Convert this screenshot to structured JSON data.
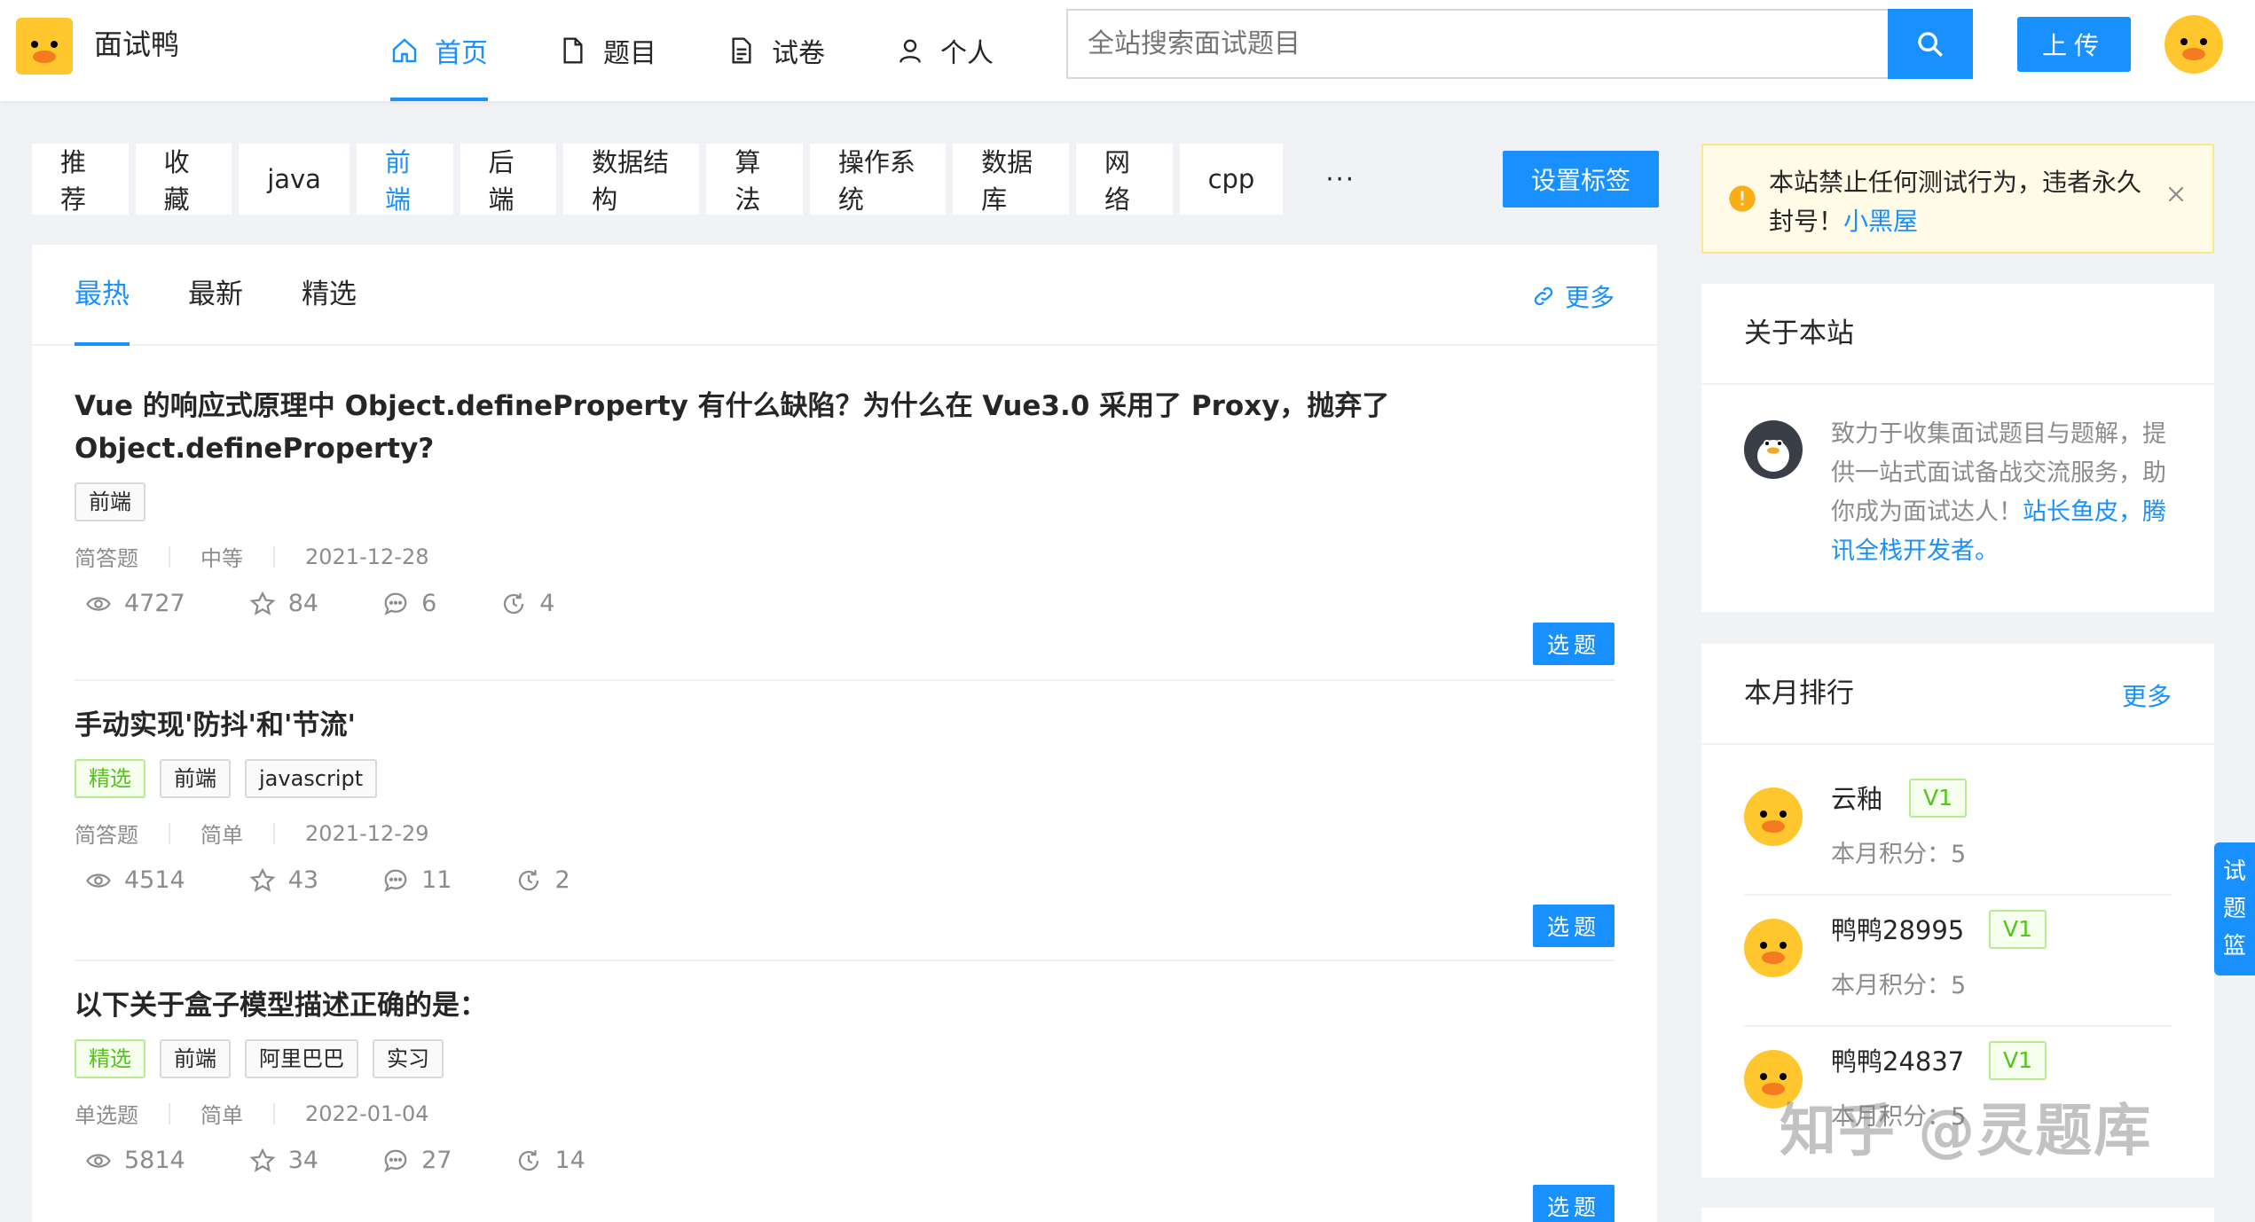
{
  "header": {
    "site_name": "面试鸭",
    "nav": [
      {
        "label": "首页",
        "icon": "home-icon",
        "active": true
      },
      {
        "label": "题目",
        "icon": "file-icon",
        "active": false
      },
      {
        "label": "试卷",
        "icon": "paper-icon",
        "active": false
      },
      {
        "label": "个人",
        "icon": "user-icon",
        "active": false
      }
    ],
    "search_placeholder": "全站搜索面试题目",
    "upload_label": "上传"
  },
  "tag_bar": {
    "tags": [
      "推荐",
      "收藏",
      "java",
      "前端",
      "后端",
      "数据结构",
      "算法",
      "操作系统",
      "数据库",
      "网络",
      "cpp"
    ],
    "active_tag": "前端",
    "more": "···",
    "set_tags_label": "设置标签"
  },
  "main": {
    "tabs": [
      "最热",
      "最新",
      "精选"
    ],
    "active_tab": "最热",
    "more_label": "更多",
    "pick_label": "选题",
    "questions": [
      {
        "title": "Vue 的响应式原理中 Object.defineProperty 有什么缺陷？为什么在 Vue3.0 采用了 Proxy，抛弃了 Object.defineProperty?",
        "tags": [
          "前端"
        ],
        "type": "简答题",
        "difficulty": "中等",
        "date": "2021-12-28",
        "views": "4727",
        "stars": "84",
        "comments": "6",
        "history": "4"
      },
      {
        "title": "手动实现'防抖'和'节流'",
        "tags": [
          "精选",
          "前端",
          "javascript"
        ],
        "type": "简答题",
        "difficulty": "简单",
        "date": "2021-12-29",
        "views": "4514",
        "stars": "43",
        "comments": "11",
        "history": "2"
      },
      {
        "title": "以下关于盒子模型描述正确的是：",
        "tags": [
          "精选",
          "前端",
          "阿里巴巴",
          "实习"
        ],
        "type": "单选题",
        "difficulty": "简单",
        "date": "2022-01-04",
        "views": "5814",
        "stars": "34",
        "comments": "27",
        "history": "14"
      }
    ]
  },
  "alert": {
    "text": "本站禁止任何测试行为，违者永久封号！",
    "link": "小黑屋"
  },
  "about": {
    "title": "关于本站",
    "text": "致力于收集面试题目与题解，提供一站式面试备战交流服务，助你成为面试达人！",
    "link": "站长鱼皮，腾讯全栈开发者。"
  },
  "ranking": {
    "title": "本月排行",
    "more_label": "更多",
    "score_label": "本月积分：",
    "users": [
      {
        "name": "云釉",
        "level": "V1",
        "score": "5"
      },
      {
        "name": "鸭鸭28995",
        "level": "V1",
        "score": "5"
      },
      {
        "name": "鸭鸭24837",
        "level": "V1",
        "score": "5"
      }
    ]
  },
  "basket": [
    "试",
    "题",
    "篮"
  ],
  "watermark": "知乎 @灵题库",
  "colors": {
    "primary": "#1890ff",
    "featured": "#52c41a",
    "warning": "#faad14",
    "duck": "#ffc62d"
  }
}
